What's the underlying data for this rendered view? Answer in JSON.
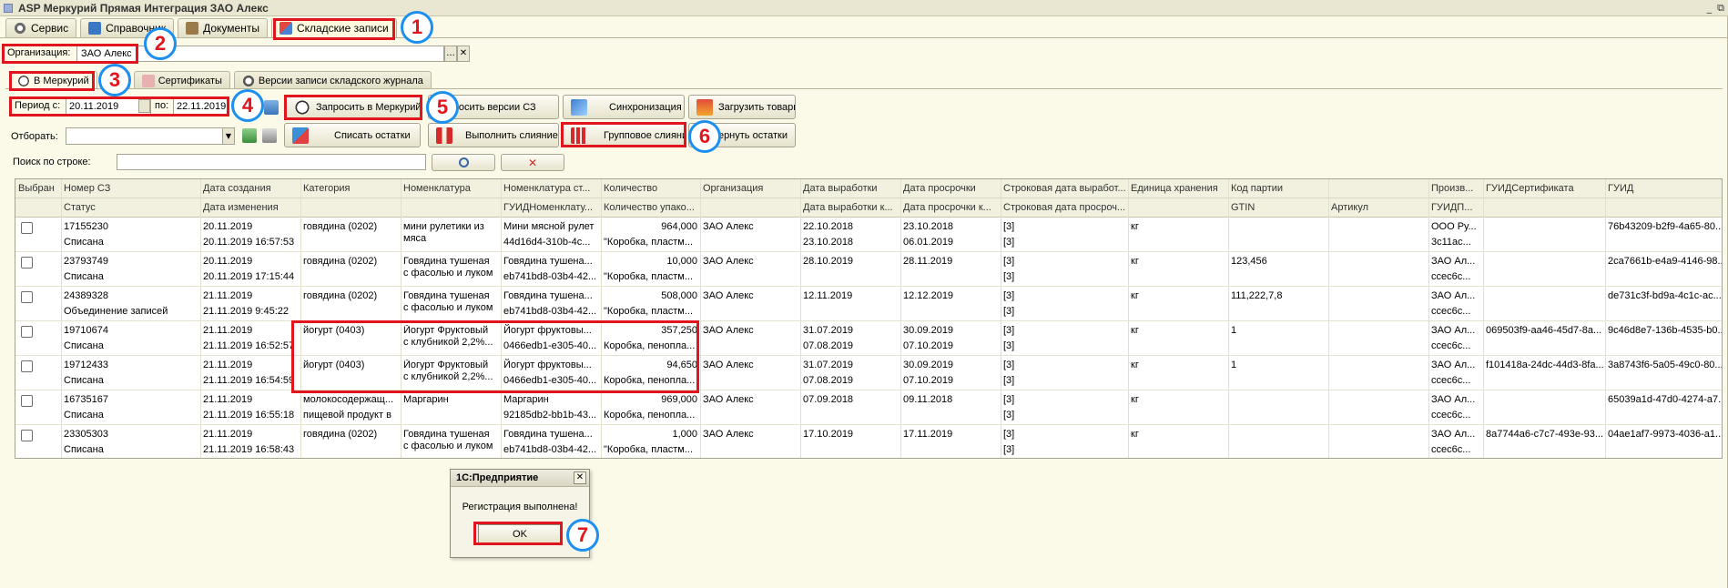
{
  "window": {
    "title": "ASP Меркурий Прямая Интеграция ЗАО Алекс",
    "controls": [
      "_",
      "⧉"
    ]
  },
  "top_tabs": [
    {
      "label": "Сервис",
      "icon": "gear-icon"
    },
    {
      "label": "Справочник",
      "icon": "book-icon"
    },
    {
      "label": "Документы",
      "icon": "briefcase-icon"
    },
    {
      "label": "Складские записи",
      "icon": "stock-records-icon",
      "active": true
    }
  ],
  "organization": {
    "label": "Организация:",
    "value": "ЗАО Алекс",
    "buttons": [
      "...",
      "✕"
    ]
  },
  "sub_tabs": [
    {
      "label": "В Меркурий",
      "icon": "mercury-icon",
      "active": true
    },
    {
      "label": "1С"
    },
    {
      "label": "Сертификаты",
      "icon": "certificate-icon"
    },
    {
      "label": "Версии записи складского журнала",
      "icon": "versions-icon"
    }
  ],
  "period": {
    "from_label": "Период с:",
    "from_value": "20.11.2019",
    "to_label": "по:",
    "to_value": "22.11.2019"
  },
  "buttons": {
    "request_mercury": "Запросить в Меркурий",
    "request_versions": "Запросить версии СЗ",
    "sync": "Синхронизация",
    "load_goods": "Загрузить товары",
    "write_off": "Списать остатки",
    "merge": "Выполнить слияние",
    "group_merge": "Групповое слияние",
    "restore": "Вернуть остатки"
  },
  "filter": {
    "label": "Отборать:",
    "value": ""
  },
  "search": {
    "label": "Поиск по строке:",
    "value": ""
  },
  "grid": {
    "headers_top": [
      "Выбран",
      "Номер СЗ",
      "Дата создания",
      "Категория",
      "Номенклатура",
      "Номенклатура ст...",
      "Количество",
      "Организация",
      "Дата выработки",
      "Дата просрочки",
      "Строковая дата выработ...",
      "Единица хранения",
      "Код партии",
      "",
      "Произв...",
      "ГУИДСертификата",
      "ГУИД"
    ],
    "headers_bottom": [
      "",
      "Статус",
      "Дата изменения",
      "",
      "",
      "ГУИДНоменклату...",
      "Количество упако...",
      "",
      "Дата выработки к...",
      "Дата просрочки к...",
      "Строковая дата просроч...",
      "",
      "GTIN",
      "Артикул",
      "ГУИДП...",
      "",
      ""
    ],
    "rows": [
      {
        "num": "17155230",
        "status": "Списана",
        "created": "20.11.2019",
        "changed": "20.11.2019 16:57:53",
        "category": "говядина (0202)",
        "nom": [
          "мини рулетики из",
          "мяса"
        ],
        "nom_st": "Мини мясной рулет",
        "guid_nom": "44d16d4-310b-4c...",
        "qty": "964,000",
        "qty_pack": "\"Коробка, пластм...",
        "org": "ЗАО Алекс",
        "prod_date": "22.10.2018",
        "prod_date2": "23.10.2018",
        "exp_date": "23.10.2018",
        "exp_date2": "06.01.2019",
        "str_prod": "[3]",
        "str_exp": "[3]",
        "unit": "кг",
        "batch": "",
        "article": "",
        "producer": "ООО Ру...",
        "producer_guid": "3c11ac...",
        "cert_guid": "",
        "guid": "76b43209-b2f9-4a65-80..."
      },
      {
        "num": "23793749",
        "status": "Списана",
        "created": "20.11.2019",
        "changed": "20.11.2019 17:15:44",
        "category": "говядина (0202)",
        "nom": [
          "Говядина тушеная",
          "с фасолью и луком"
        ],
        "nom_st": "Говядина тушена...",
        "guid_nom": "eb741bd8-03b4-42...",
        "qty": "10,000",
        "qty_pack": "\"Коробка, пластм...",
        "org": "ЗАО Алекс",
        "prod_date": "28.10.2019",
        "prod_date2": "",
        "exp_date": "28.11.2019",
        "exp_date2": "",
        "str_prod": "[3]",
        "str_exp": "[3]",
        "unit": "кг",
        "batch": "123,456",
        "article": "",
        "producer": "ЗАО Ал...",
        "producer_guid": "ccec6c...",
        "cert_guid": "",
        "guid": "2ca7661b-e4a9-4146-98..."
      },
      {
        "num": "24389328",
        "status": "Объединение записей",
        "created": "21.11.2019",
        "changed": "21.11.2019 9:45:22",
        "category": "говядина (0202)",
        "nom": [
          "Говядина тушеная",
          "с фасолью и луком"
        ],
        "nom_st": "Говядина тушена...",
        "guid_nom": "eb741bd8-03b4-42...",
        "qty": "508,000",
        "qty_pack": "\"Коробка, пластм...",
        "org": "ЗАО Алекс",
        "prod_date": "12.11.2019",
        "prod_date2": "",
        "exp_date": "12.12.2019",
        "exp_date2": "",
        "str_prod": "[3]",
        "str_exp": "[3]",
        "unit": "кг",
        "batch": "111,222,7,8",
        "article": "",
        "producer": "ЗАО Ал...",
        "producer_guid": "ccec6c...",
        "cert_guid": "",
        "guid": "de731c3f-bd9a-4c1c-ac..."
      },
      {
        "num": "19710674",
        "status": "Списана",
        "created": "21.11.2019",
        "changed": "21.11.2019 16:52:57",
        "category": "йогурт (0403)",
        "nom": [
          "Йогурт Фруктовый",
          "с клубникой 2,2%..."
        ],
        "nom_st": "Йогурт фруктовы...",
        "guid_nom": "0466edb1-e305-40...",
        "qty": "357,250",
        "qty_pack": "Коробка, пенопла...",
        "org": "ЗАО Алекс",
        "prod_date": "31.07.2019",
        "prod_date2": "07.08.2019",
        "exp_date": "30.09.2019",
        "exp_date2": "07.10.2019",
        "str_prod": "[3]",
        "str_exp": "[3]",
        "unit": "кг",
        "batch": "1",
        "article": "",
        "producer": "ЗАО Ал...",
        "producer_guid": "ccec6c...",
        "cert_guid": "069503f9-aa46-45d7-8a...",
        "guid": "9c46d8e7-136b-4535-b0..."
      },
      {
        "num": "19712433",
        "status": "Списана",
        "created": "21.11.2019",
        "changed": "21.11.2019 16:54:59",
        "category": "йогурт (0403)",
        "nom": [
          "Йогурт Фруктовый",
          "с клубникой 2,2%..."
        ],
        "nom_st": "Йогурт фруктовы...",
        "guid_nom": "0466edb1-e305-40...",
        "qty": "94,650",
        "qty_pack": "Коробка, пенопла...",
        "org": "ЗАО Алекс",
        "prod_date": "31.07.2019",
        "prod_date2": "07.08.2019",
        "exp_date": "30.09.2019",
        "exp_date2": "07.10.2019",
        "str_prod": "[3]",
        "str_exp": "[3]",
        "unit": "кг",
        "batch": "1",
        "article": "",
        "producer": "ЗАО Ал...",
        "producer_guid": "ccec6c...",
        "cert_guid": "f101418a-24dc-44d3-8fa...",
        "guid": "3a8743f6-5a05-49c0-80..."
      },
      {
        "num": "16735167",
        "status": "Списана",
        "created": "21.11.2019",
        "changed": "21.11.2019 16:55:18",
        "category": "молокосодержащ...",
        "category2": "пищевой продукт в",
        "nom": [
          "Маргарин",
          ""
        ],
        "nom_st": "Маргарин",
        "guid_nom": "92185db2-bb1b-43...",
        "qty": "969,000",
        "qty_pack": "Коробка, пенопла...",
        "org": "ЗАО Алекс",
        "prod_date": "07.09.2018",
        "prod_date2": "",
        "exp_date": "09.11.2018",
        "exp_date2": "",
        "str_prod": "[3]",
        "str_exp": "[3]",
        "unit": "кг",
        "batch": "",
        "article": "",
        "producer": "ЗАО Ал...",
        "producer_guid": "ccec6c...",
        "cert_guid": "",
        "guid": "65039a1d-47d0-4274-a7..."
      },
      {
        "num": "23305303",
        "status": "Списана",
        "created": "21.11.2019",
        "changed": "21.11.2019 16:58:43",
        "category": "говядина (0202)",
        "nom": [
          "Говядина тушеная",
          "с фасолью и луком"
        ],
        "nom_st": "Говядина тушена...",
        "guid_nom": "eb741bd8-03b4-42...",
        "qty": "1,000",
        "qty_pack": "\"Коробка, пластм...",
        "org": "ЗАО Алекс",
        "prod_date": "17.10.2019",
        "prod_date2": "",
        "exp_date": "17.11.2019",
        "exp_date2": "",
        "str_prod": "[3]",
        "str_exp": "[3]",
        "unit": "кг",
        "batch": "",
        "article": "",
        "producer": "ЗАО Ал...",
        "producer_guid": "ccec6c...",
        "cert_guid": "8a7744a6-c7c7-493e-93...",
        "guid": "04ae1af7-9973-4036-a1..."
      }
    ]
  },
  "dialog": {
    "title": "1С:Предприятие",
    "message": "Регистрация выполнена!",
    "ok": "OK",
    "close": "✕"
  },
  "annotations": [
    "1",
    "2",
    "3",
    "4",
    "5",
    "6",
    "7"
  ],
  "colors": {
    "annotation_red": "#e0151d",
    "annotation_blue": "#1c8ff0",
    "background": "#fbf9e8"
  }
}
